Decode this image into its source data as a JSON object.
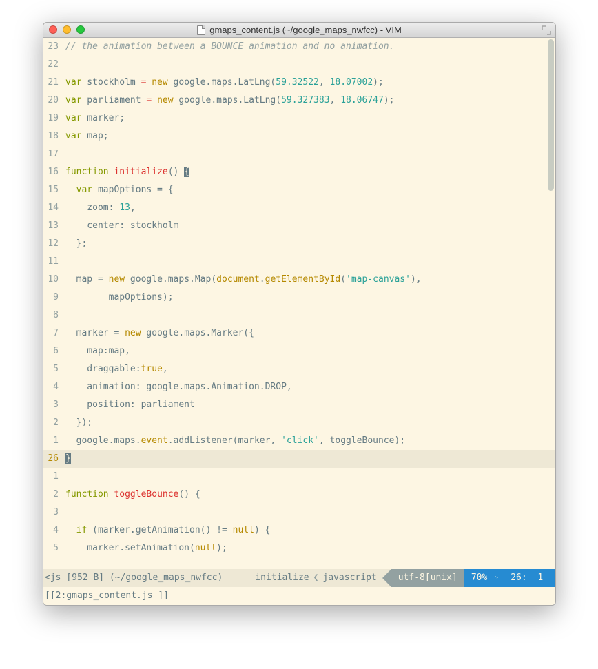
{
  "window": {
    "title": "gmaps_content.js (~/google_maps_nwfcc) - VIM"
  },
  "gutter": [
    "23",
    "22",
    "21",
    "20",
    "19",
    "18",
    "17",
    "16",
    "15",
    "14",
    "13",
    "12",
    "11",
    "10",
    "9",
    "8",
    "7",
    "6",
    "5",
    "4",
    "3",
    "2",
    "1",
    "26",
    "1",
    "2",
    "3",
    "4",
    "5"
  ],
  "code": {
    "l0_comment": "// the animation between a BOUNCE animation and no animation.",
    "l2_var": "var",
    "l2_name": " stockholm ",
    "l2_eq": "= ",
    "l2_new": "new",
    "l2_goo": " google.maps.LatLng(",
    "l2_n1": "59.32522",
    "l2_c": ", ",
    "l2_n2": "18.07002",
    "l2_end": ");",
    "l3_name": " parliament ",
    "l3_n1": "59.327383",
    "l3_n2": "18.06747",
    "l4": " marker;",
    "l5": " map;",
    "l7_fn": "function",
    "l7_name": " initialize",
    "l7_par": "() ",
    "l7_brace": "{",
    "l8_var": "var",
    "l8_rest": " mapOptions = {",
    "l9_zoom": "    zoom: ",
    "l9_n": "13",
    "l9_c": ",",
    "l10": "    center: stockholm",
    "l11": "  };",
    "l13_a": "  map = ",
    "l13_b": " google.maps.Map(",
    "l13_doc": "document",
    "l13_dot": ".",
    "l13_get": "getElementById",
    "l13_p": "(",
    "l13_str": "'map-canvas'",
    "l13_end": "),",
    "l14": "        mapOptions);",
    "l16_a": "  marker = ",
    "l16_b": " google.maps.Marker({",
    "l17": "    map:map,",
    "l18_a": "    draggable:",
    "l18_b": "true",
    "l18_c": ",",
    "l19": "    animation: google.maps.Animation.DROP,",
    "l20": "    position: parliament",
    "l21": "  });",
    "l22_a": "  google.maps.",
    "l22_ev": "event",
    "l22_b": ".addListener(marker, ",
    "l22_str": "'click'",
    "l22_c": ", toggleBounce);",
    "l23": "}",
    "l25_fn": "function",
    "l25_name": " toggleBounce",
    "l25_par": "() {",
    "l27_a": "  ",
    "l27_if": "if",
    "l27_b": " (marker.getAnimation() != ",
    "l27_null": "null",
    "l27_c": ") {",
    "l28_a": "    marker.setAnimation(",
    "l28_null": "null",
    "l28_b": ");"
  },
  "status": {
    "file_seg": "<js [952 B] (~/google_maps_nwfcc)",
    "fn": "initialize",
    "ft": "javascript",
    "enc": "utf-8[unix]",
    "pct": "70%",
    "lineno": "26:",
    "col": "1",
    "tabs": "[[2:gmaps_content.js ]]"
  }
}
